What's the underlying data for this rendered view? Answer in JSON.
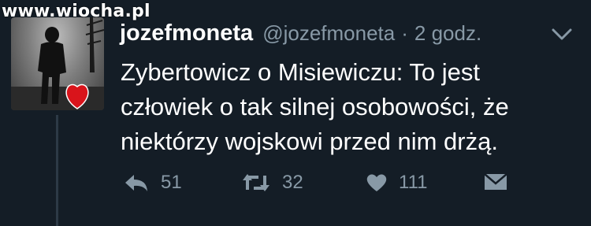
{
  "watermark": "www.wiocha.pl",
  "tweet": {
    "display_name": "jozefmoneta",
    "handle": "@jozefmoneta",
    "separator": "·",
    "time": "2 godz.",
    "text_lines": [
      "Zybertowicz o Misiewiczu: To jest",
      "człowiek o tak silnej osobowości, że",
      "niektórzy wojskowi przed nim drżą."
    ]
  },
  "actions": {
    "reply_count": "51",
    "retweet_count": "32",
    "like_count": "111"
  },
  "icons": {
    "reply": "reply-icon",
    "retweet": "retweet-icon",
    "like": "heart-icon",
    "message": "envelope-icon",
    "menu": "chevron-down-icon"
  },
  "colors": {
    "background": "#141d26",
    "text": "#ffffff",
    "muted": "#8899a6",
    "thread_line": "#2d3a46",
    "heart_badge": "#d9141b"
  }
}
